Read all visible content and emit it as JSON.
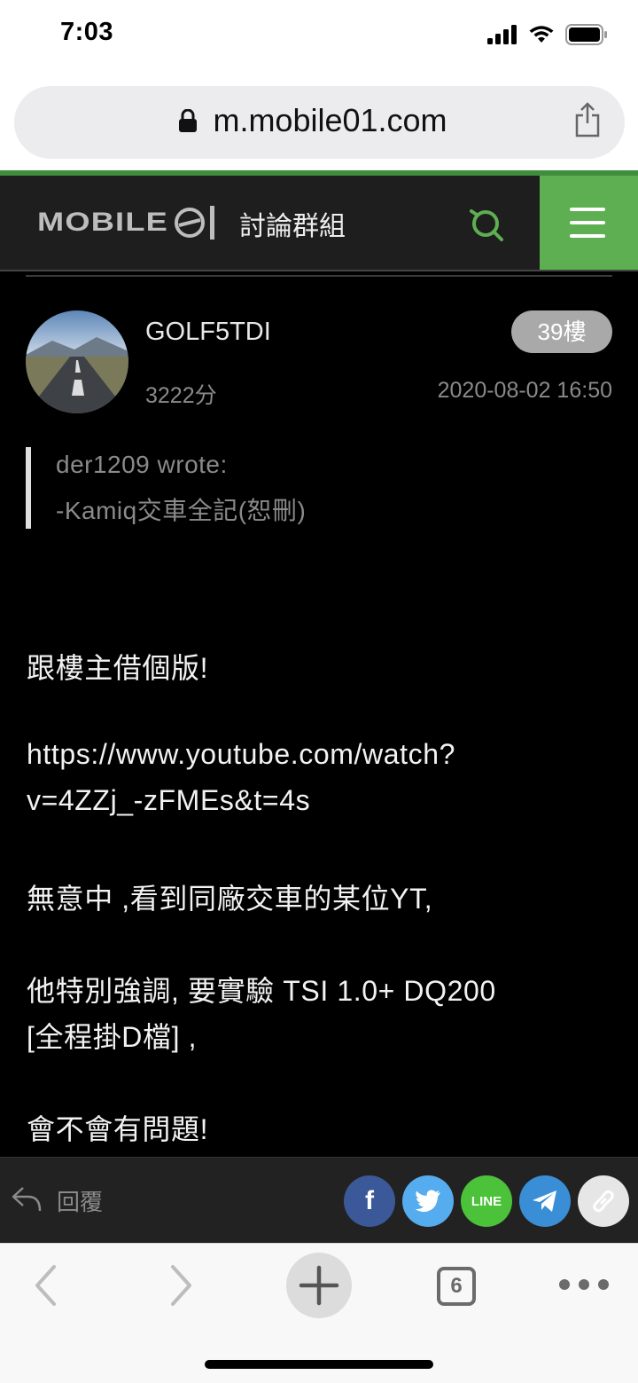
{
  "status_bar": {
    "time": "7:03"
  },
  "browser": {
    "url": "m.mobile01.com",
    "tab_count": "6"
  },
  "header": {
    "logo_text": "MOBILE01",
    "title": "討論群組",
    "accent_color": "#5eae52"
  },
  "post": {
    "username": "GOLF5TDI",
    "floor": "39樓",
    "score": "3222分",
    "date": "2020-08-02 16:50",
    "quote": {
      "author_line": "der1209 wrote:",
      "text": "-Kamiq交車全記(恕刪)"
    },
    "body_lines": [
      "跟樓主借個版!",
      "https://www.youtube.com/watch?",
      "v=4ZZj_-zFMEs&t=4s",
      "無意中 ,看到同廠交車的某位YT,",
      "他特別強調, 要實驗 TSI 1.0+ DQ200",
      "[全程掛D檔] ,",
      "會不會有問題!"
    ]
  },
  "actions": {
    "reply_label": "回覆",
    "share_buttons": [
      {
        "name": "facebook",
        "label": "f",
        "color": "#3b5998"
      },
      {
        "name": "twitter",
        "label": "",
        "color": "#55acee"
      },
      {
        "name": "line",
        "label": "LINE",
        "color": "#4cc13a"
      },
      {
        "name": "telegram",
        "label": "",
        "color": "#3a8ed6"
      },
      {
        "name": "link",
        "label": "",
        "color": "#e6e6e6"
      }
    ]
  }
}
